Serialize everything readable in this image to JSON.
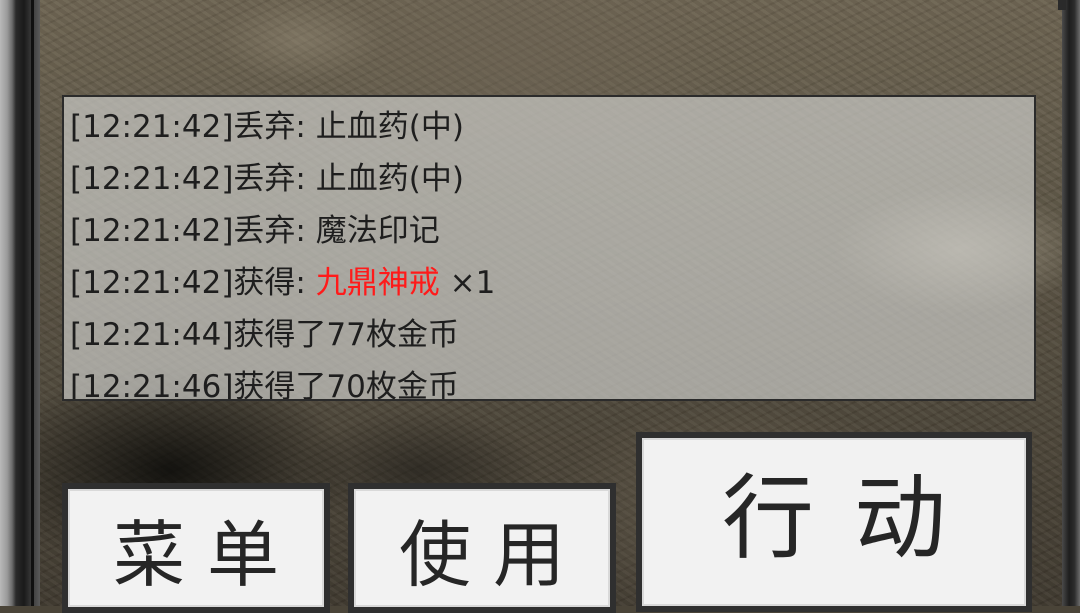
{
  "log": {
    "lines": [
      {
        "time": "[12:21:42]",
        "text": "丢弃: 止血药(中)"
      },
      {
        "time": "[12:21:42]",
        "text": "丢弃: 止血药(中)"
      },
      {
        "time": "[12:21:42]",
        "text": "丢弃: 魔法印记"
      },
      {
        "time": "[12:21:42]",
        "text": "获得: ",
        "item": "九鼎神戒",
        "qty": " ×1",
        "item_color": "#ff1a1a"
      },
      {
        "time": "[12:21:44]",
        "text": "获得了77枚金币"
      },
      {
        "time": "[12:21:46]",
        "text": "获得了70枚金币"
      }
    ]
  },
  "buttons": {
    "menu": "菜单",
    "use": "使用",
    "action": "行动"
  }
}
